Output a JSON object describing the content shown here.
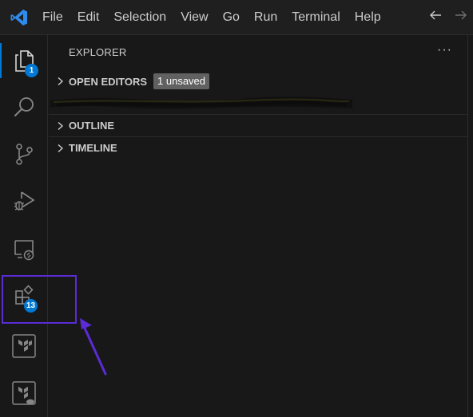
{
  "titlebar": {
    "menu": [
      "File",
      "Edit",
      "Selection",
      "View",
      "Go",
      "Run",
      "Terminal",
      "Help"
    ],
    "nav": {
      "back_icon": "arrow-left-icon",
      "forward_icon": "arrow-right-icon"
    }
  },
  "activity_bar": {
    "items": [
      {
        "name": "explorer",
        "icon": "files-icon",
        "active": true,
        "badge": "1"
      },
      {
        "name": "search",
        "icon": "search-icon"
      },
      {
        "name": "source-control",
        "icon": "source-control-icon"
      },
      {
        "name": "run-and-debug",
        "icon": "run-debug-icon"
      },
      {
        "name": "remote-explorer",
        "icon": "remote-explorer-icon"
      },
      {
        "name": "extensions",
        "icon": "extensions-icon",
        "badge": "13",
        "highlighted": true
      },
      {
        "name": "terraform",
        "icon": "terraform-icon"
      },
      {
        "name": "terraform-cloud",
        "icon": "terraform-cloud-icon"
      }
    ]
  },
  "sidebar": {
    "title": "EXPLORER",
    "more_icon": "ellipsis-icon",
    "sections": [
      {
        "label": "OPEN EDITORS",
        "badge": "1 unsaved",
        "collapsed": true
      },
      {
        "label": "OUTLINE",
        "collapsed": true
      },
      {
        "label": "TIMELINE",
        "collapsed": true
      }
    ]
  },
  "colors": {
    "accent": "#0078d4",
    "highlight_box": "#5b2bd6",
    "background": "#181818"
  }
}
